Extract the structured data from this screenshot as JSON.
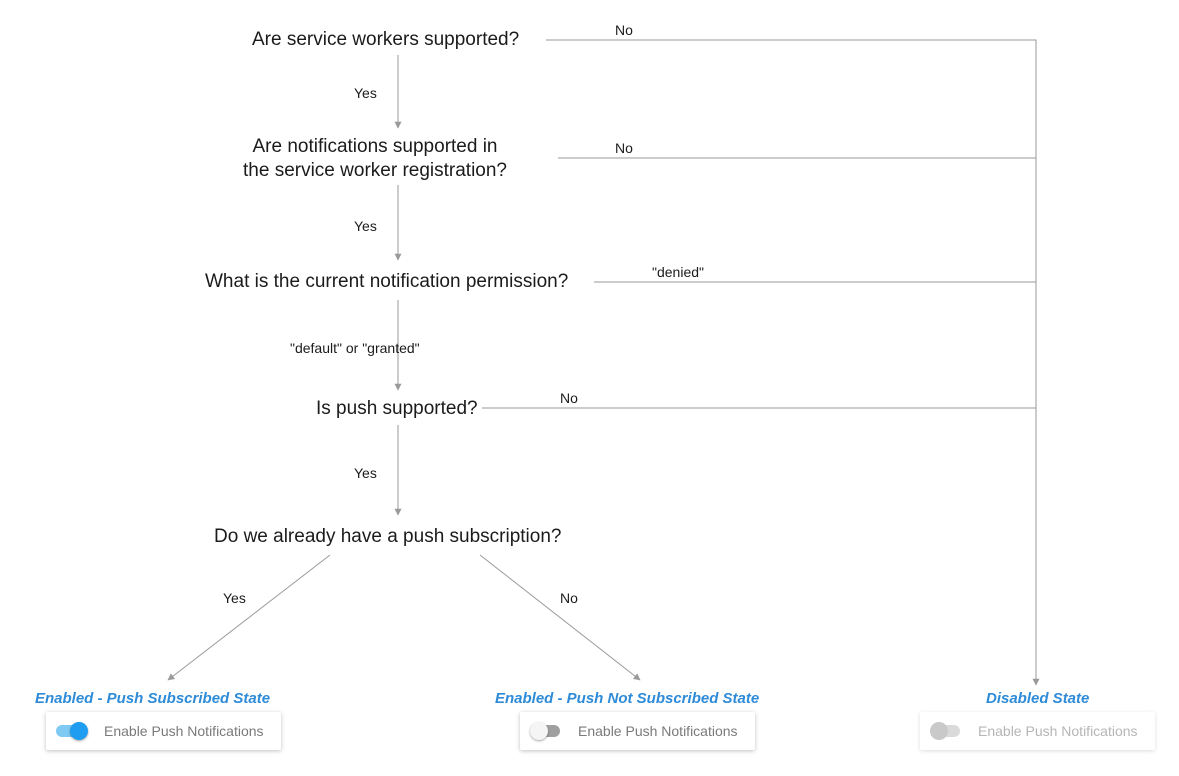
{
  "nodes": {
    "q1": "Are service workers supported?",
    "q2": "Are notifications supported in\nthe service worker registration?",
    "q3": "What is the current notification permission?",
    "q4": "Is push supported?",
    "q5": "Do we already have a push subscription?"
  },
  "edges": {
    "yes": "Yes",
    "no": "No",
    "default_or_granted": "\"default\" or \"granted\"",
    "denied": "\"denied\""
  },
  "states": {
    "subscribed": {
      "title": "Enabled - Push Subscribed State",
      "label": "Enable Push Notifications",
      "switch": "on"
    },
    "not_subscribed": {
      "title": "Enabled - Push Not Subscribed State",
      "label": "Enable Push Notifications",
      "switch": "off"
    },
    "disabled": {
      "title": "Disabled State",
      "label": "Enable Push Notifications",
      "switch": "dis"
    }
  }
}
